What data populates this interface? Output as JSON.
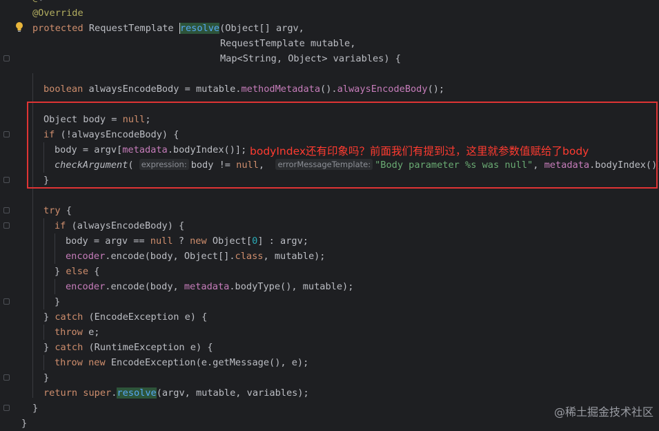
{
  "editor": {
    "annotation_override": "@Override",
    "line_method": [
      "protected",
      "RequestTemplate",
      "resolve",
      "(Object[] argv,"
    ],
    "line_param2": "RequestTemplate mutable,",
    "line_param3": [
      "Map<String, Object> variables) {"
    ],
    "line_bool": [
      "boolean",
      "alwaysEncodeBody = mutable.",
      "methodMetadata",
      "().",
      "alwaysEncodeBody",
      "();"
    ],
    "line_obj": [
      "Object body = ",
      "null",
      ";"
    ],
    "line_if": [
      "if",
      " (!alwaysEncodeBody) {"
    ],
    "line_body": [
      "body = argv[",
      "metadata",
      ".bodyIndex()];"
    ],
    "line_check": {
      "fn": "checkArgument",
      "hint1": "expression:",
      "part1": "body != ",
      "null": "null",
      "hint2": "errorMessageTemplate:",
      "str": "\"Body parameter %s was null\"",
      "part2": ", ",
      "fld": "metadata",
      "part3": ".bodyIndex());"
    },
    "close_brace": "}",
    "line_try": [
      "try",
      " {"
    ],
    "line_if2": [
      "if",
      " (alwaysEncodeBody) {"
    ],
    "line_body2": [
      "body = argv == ",
      "null",
      " ? ",
      "new",
      " Object[",
      "0",
      "] : argv;"
    ],
    "line_enc1": [
      "encoder",
      ".encode(body, Object[].",
      "class",
      ", mutable);"
    ],
    "line_else": [
      "} ",
      "else",
      " {"
    ],
    "line_enc2": [
      "encoder",
      ".encode(body, ",
      "metadata",
      ".bodyType(), mutable);"
    ],
    "line_catch1": [
      "} ",
      "catch",
      " (EncodeException e) {"
    ],
    "line_throw1": [
      "throw",
      " e;"
    ],
    "line_catch2": [
      "} ",
      "catch",
      " (RuntimeException e) {"
    ],
    "line_throw2": [
      "throw",
      " ",
      "new",
      " EncodeException(e.getMessage(), e);"
    ],
    "line_return": [
      "return",
      " ",
      "super",
      ".",
      "resolve",
      "(argv, mutable, variables);"
    ]
  },
  "annotation_note": "bodyIndex还有印象吗？前面我们有提到过，这里就参数值赋给了body",
  "watermark": "@稀土掘金技术社区",
  "colors": {
    "background": "#1e1f22",
    "keyword": "#cf8e6d",
    "string": "#6aab73",
    "field": "#c77dbb",
    "method": "#56a8f5",
    "annotation_box": "#e03434"
  }
}
